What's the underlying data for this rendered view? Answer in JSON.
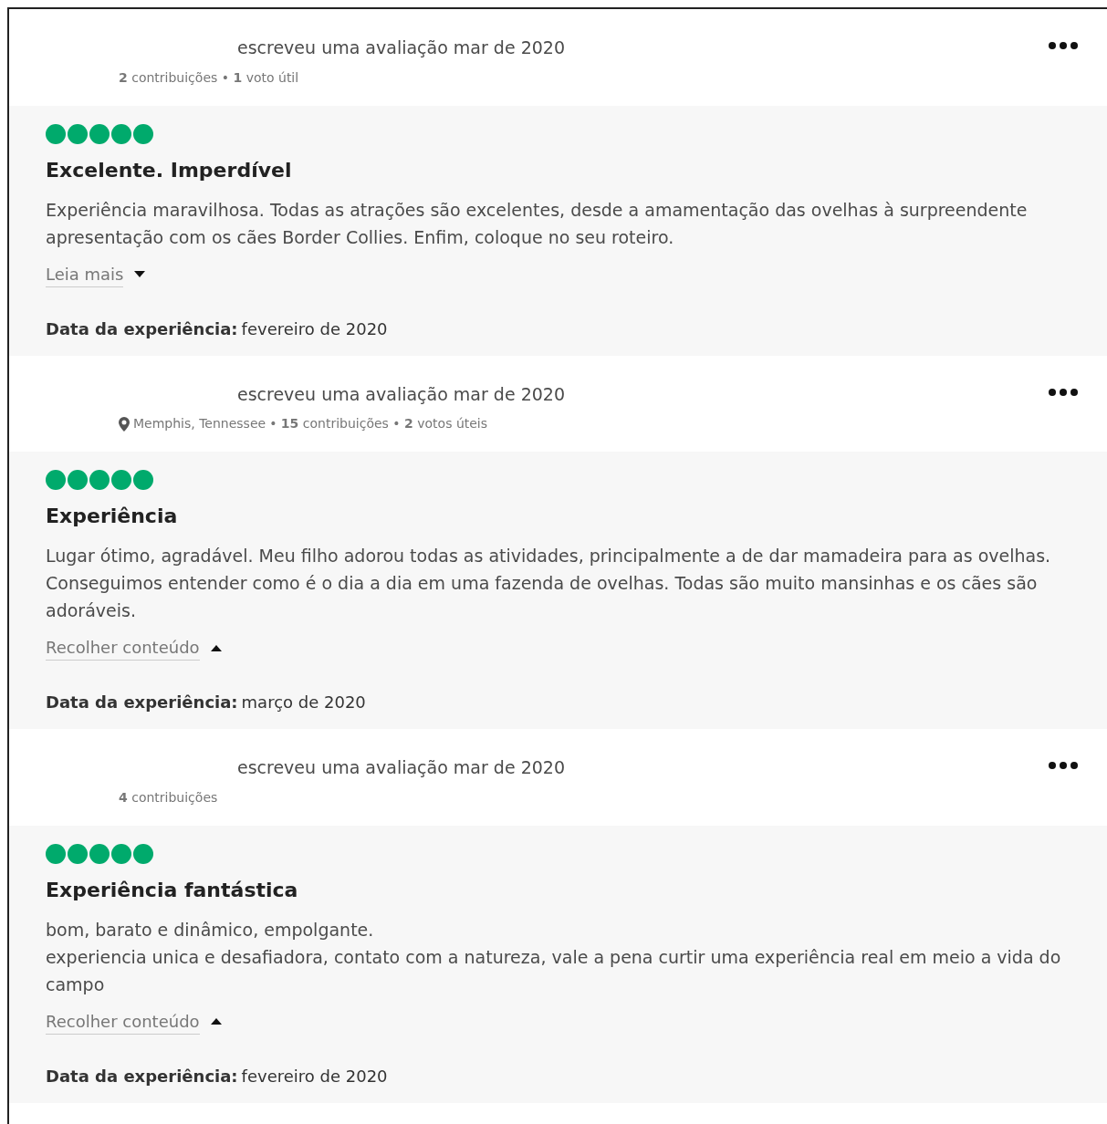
{
  "reviews": [
    {
      "author_line": "escreveu uma avaliação mar de 2020",
      "meta": "**2** contribuições • **1** voto útil",
      "stars": 5,
      "title": "Excelente. Imperdível",
      "paragraphs": [
        "Experiência maravilhosa. Todas as atrações são excelentes, desde a amamentação das ovelhas à surpreendente apresentação com os cães Border Collies. Enfim, coloque no seu roteiro."
      ],
      "toggle": {
        "label": "Leia mais",
        "expanded": false
      },
      "date_label": "Data da experiência:",
      "date_value": "fevereiro de 2020"
    },
    {
      "author_line": "escreveu uma avaliação mar de 2020",
      "location": "Memphis, Tennessee",
      "meta": "• **15** contribuições • **2** votos úteis",
      "stars": 5,
      "title": "Experiência",
      "paragraphs": [
        "Lugar ótimo, agradável. Meu filho adorou todas as atividades, principalmente a de dar mamadeira para as ovelhas. Conseguimos entender como é o dia a dia em uma fazenda de ovelhas. Todas são muito mansinhas e os cães são adoráveis."
      ],
      "toggle": {
        "label": "Recolher conteúdo",
        "expanded": true
      },
      "date_label": "Data da experiência:",
      "date_value": "março de 2020"
    },
    {
      "author_line": "escreveu uma avaliação mar de 2020",
      "meta": "**4** contribuições",
      "stars": 5,
      "title": "Experiência fantástica",
      "paragraphs": [
        "bom, barato e dinâmico, empolgante.",
        "experiencia unica e desafiadora, contato com a natureza, vale a pena curtir uma experiência real em meio a vida do campo"
      ],
      "toggle": {
        "label": "Recolher conteúdo",
        "expanded": true
      },
      "date_label": "Data da experiência:",
      "date_value": "fevereiro de 2020"
    }
  ]
}
